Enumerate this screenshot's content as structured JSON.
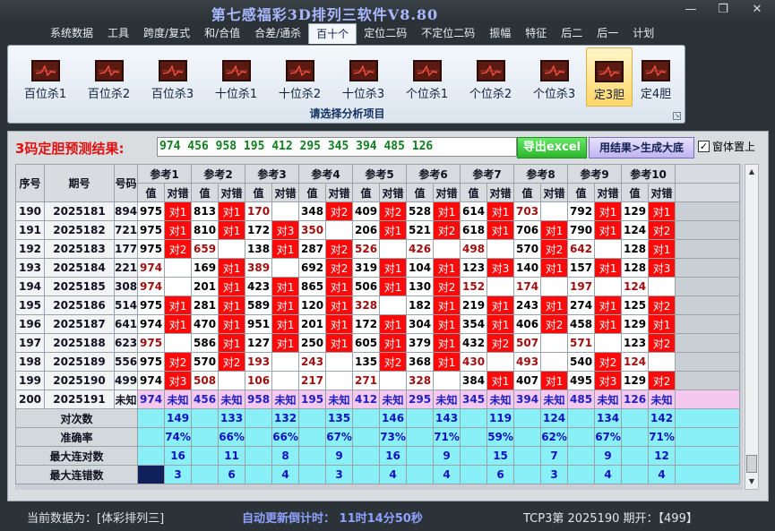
{
  "app": {
    "title": "第七感福彩3D排列三软件V8.80"
  },
  "window_buttons": [
    {
      "name": "minimize-button",
      "glyph": "—"
    },
    {
      "name": "restore-button",
      "glyph": "❐"
    },
    {
      "name": "close-button",
      "glyph": "✕"
    }
  ],
  "menu": [
    {
      "label": "系统数据",
      "active": false
    },
    {
      "label": "工具",
      "active": false
    },
    {
      "label": "跨度/复式",
      "active": false
    },
    {
      "label": "和/合值",
      "active": false
    },
    {
      "label": "合差/通杀",
      "active": false
    },
    {
      "label": "百十个",
      "active": true
    },
    {
      "label": "定位二码",
      "active": false
    },
    {
      "label": "不定位二码",
      "active": false
    },
    {
      "label": "振幅",
      "active": false
    },
    {
      "label": "特征",
      "active": false
    },
    {
      "label": "后二",
      "active": false
    },
    {
      "label": "后一",
      "active": false
    },
    {
      "label": "计划",
      "active": false
    }
  ],
  "ribbon": {
    "items": [
      {
        "label": "百位杀1",
        "selected": false
      },
      {
        "label": "百位杀2",
        "selected": false
      },
      {
        "label": "百位杀3",
        "selected": false
      },
      {
        "label": "十位杀1",
        "selected": false
      },
      {
        "label": "十位杀2",
        "selected": false
      },
      {
        "label": "十位杀3",
        "selected": false
      },
      {
        "label": "个位杀1",
        "selected": false
      },
      {
        "label": "个位杀2",
        "selected": false
      },
      {
        "label": "个位杀3",
        "selected": false
      },
      {
        "label": "定3胆",
        "selected": true
      },
      {
        "label": "定4胆",
        "selected": false
      }
    ],
    "caption": "请选择分析项目",
    "icon": "chart-icon"
  },
  "prediction": {
    "label": "3码定胆预测结果:",
    "value": "974 456 958 195 412 295 345 394 485 126",
    "excel_button": "导出excel",
    "generate_button": "用结果>生成大底",
    "ontop_checkbox": {
      "label": "窗体置上",
      "checked": true
    }
  },
  "table": {
    "headers": {
      "seq": "序号",
      "period": "期号",
      "code": "号码",
      "val": "值",
      "mark": "对错"
    },
    "refs": [
      "参考1",
      "参考2",
      "参考3",
      "参考4",
      "参考5",
      "参考6",
      "参考7",
      "参考8",
      "参考9",
      "参考10"
    ],
    "rows": [
      {
        "seq": "190",
        "period": "2025181",
        "code": "894",
        "cells": [
          [
            "975",
            "对1"
          ],
          [
            "813",
            "对1"
          ],
          [
            "170",
            ""
          ],
          [
            "348",
            "对2"
          ],
          [
            "409",
            "对2"
          ],
          [
            "528",
            "对1"
          ],
          [
            "614",
            "对1"
          ],
          [
            "703",
            ""
          ],
          [
            "792",
            "对1"
          ],
          [
            "129",
            "对1"
          ]
        ]
      },
      {
        "seq": "191",
        "period": "2025182",
        "code": "721",
        "cells": [
          [
            "975",
            "对1"
          ],
          [
            "810",
            "对1"
          ],
          [
            "172",
            "对3"
          ],
          [
            "350",
            ""
          ],
          [
            "206",
            "对1"
          ],
          [
            "521",
            "对2"
          ],
          [
            "618",
            "对1"
          ],
          [
            "706",
            "对1"
          ],
          [
            "790",
            "对1"
          ],
          [
            "124",
            "对2"
          ]
        ]
      },
      {
        "seq": "192",
        "period": "2025183",
        "code": "177",
        "cells": [
          [
            "975",
            "对2"
          ],
          [
            "659",
            ""
          ],
          [
            "138",
            "对1"
          ],
          [
            "287",
            "对2"
          ],
          [
            "526",
            ""
          ],
          [
            "426",
            ""
          ],
          [
            "498",
            ""
          ],
          [
            "570",
            "对2"
          ],
          [
            "642",
            ""
          ],
          [
            "128",
            "对1"
          ]
        ]
      },
      {
        "seq": "193",
        "period": "2025184",
        "code": "221",
        "cells": [
          [
            "974",
            ""
          ],
          [
            "169",
            "对1"
          ],
          [
            "389",
            ""
          ],
          [
            "692",
            "对2"
          ],
          [
            "319",
            "对1"
          ],
          [
            "104",
            "对1"
          ],
          [
            "123",
            "对3"
          ],
          [
            "140",
            "对1"
          ],
          [
            "157",
            "对1"
          ],
          [
            "128",
            "对3"
          ]
        ]
      },
      {
        "seq": "194",
        "period": "2025185",
        "code": "308",
        "cells": [
          [
            "974",
            ""
          ],
          [
            "201",
            "对1"
          ],
          [
            "423",
            "对1"
          ],
          [
            "865",
            "对1"
          ],
          [
            "506",
            "对1"
          ],
          [
            "130",
            "对2"
          ],
          [
            "152",
            ""
          ],
          [
            "174",
            ""
          ],
          [
            "197",
            ""
          ],
          [
            "124",
            ""
          ]
        ]
      },
      {
        "seq": "195",
        "period": "2025186",
        "code": "514",
        "cells": [
          [
            "975",
            "对1"
          ],
          [
            "281",
            "对1"
          ],
          [
            "589",
            "对1"
          ],
          [
            "120",
            "对1"
          ],
          [
            "328",
            ""
          ],
          [
            "182",
            "对1"
          ],
          [
            "219",
            "对1"
          ],
          [
            "243",
            "对1"
          ],
          [
            "274",
            "对1"
          ],
          [
            "125",
            "对2"
          ]
        ]
      },
      {
        "seq": "196",
        "period": "2025187",
        "code": "641",
        "cells": [
          [
            "974",
            "对1"
          ],
          [
            "470",
            "对1"
          ],
          [
            "951",
            "对1"
          ],
          [
            "201",
            "对1"
          ],
          [
            "172",
            "对1"
          ],
          [
            "304",
            "对1"
          ],
          [
            "354",
            "对1"
          ],
          [
            "406",
            "对2"
          ],
          [
            "458",
            "对1"
          ],
          [
            "129",
            "对1"
          ]
        ]
      },
      {
        "seq": "197",
        "period": "2025188",
        "code": "623",
        "cells": [
          [
            "975",
            ""
          ],
          [
            "586",
            "对1"
          ],
          [
            "127",
            "对1"
          ],
          [
            "250",
            "对1"
          ],
          [
            "605",
            "对1"
          ],
          [
            "379",
            "对1"
          ],
          [
            "432",
            "对2"
          ],
          [
            "507",
            ""
          ],
          [
            "571",
            ""
          ],
          [
            "123",
            "对2"
          ]
        ]
      },
      {
        "seq": "198",
        "period": "2025189",
        "code": "556",
        "cells": [
          [
            "975",
            "对2"
          ],
          [
            "570",
            "对2"
          ],
          [
            "193",
            ""
          ],
          [
            "243",
            ""
          ],
          [
            "135",
            "对2"
          ],
          [
            "368",
            "对1"
          ],
          [
            "430",
            ""
          ],
          [
            "493",
            ""
          ],
          [
            "540",
            "对2"
          ],
          [
            "124",
            ""
          ]
        ]
      },
      {
        "seq": "199",
        "period": "2025190",
        "code": "499",
        "cells": [
          [
            "974",
            "对3"
          ],
          [
            "508",
            ""
          ],
          [
            "106",
            ""
          ],
          [
            "217",
            ""
          ],
          [
            "271",
            ""
          ],
          [
            "328",
            ""
          ],
          [
            "384",
            "对1"
          ],
          [
            "407",
            "对1"
          ],
          [
            "495",
            "对3"
          ],
          [
            "129",
            "对2"
          ]
        ]
      }
    ],
    "future": {
      "seq": "200",
      "period": "2025191",
      "code": "未知",
      "values": [
        "974",
        "456",
        "958",
        "195",
        "412",
        "295",
        "345",
        "394",
        "485",
        "126"
      ],
      "mark": "未知"
    },
    "stats": [
      {
        "label": "对次数",
        "values": [
          "149",
          "133",
          "132",
          "135",
          "146",
          "143",
          "119",
          "124",
          "134",
          "142"
        ]
      },
      {
        "label": "准确率",
        "values": [
          "74%",
          "66%",
          "66%",
          "67%",
          "73%",
          "71%",
          "59%",
          "62%",
          "67%",
          "71%"
        ]
      },
      {
        "label": "最大连对数",
        "values": [
          "16",
          "11",
          "8",
          "9",
          "16",
          "9",
          "15",
          "7",
          "9",
          "12"
        ]
      },
      {
        "label": "最大连错数",
        "values": [
          "3",
          "6",
          "4",
          "3",
          "4",
          "4",
          "6",
          "3",
          "4",
          "4"
        ]
      }
    ]
  },
  "status": {
    "current": "当前数据为：[体彩排列三]",
    "timer": "自动更新倒计时：  11时14分50秒",
    "tcp": "TCP3第 2025190 期开：【499】"
  }
}
